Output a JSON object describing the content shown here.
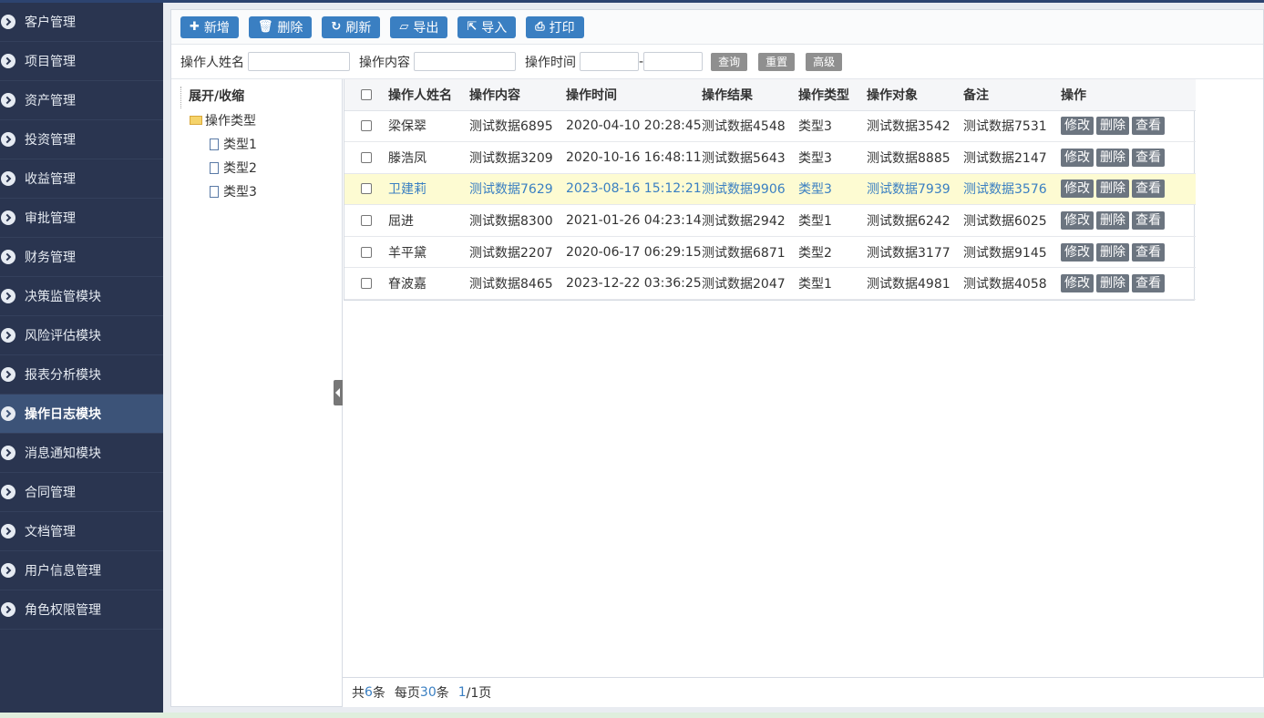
{
  "sidebar": {
    "items": [
      {
        "label": "客户管理",
        "active": false
      },
      {
        "label": "项目管理",
        "active": false
      },
      {
        "label": "资产管理",
        "active": false
      },
      {
        "label": "投资管理",
        "active": false
      },
      {
        "label": "收益管理",
        "active": false
      },
      {
        "label": "审批管理",
        "active": false
      },
      {
        "label": "财务管理",
        "active": false
      },
      {
        "label": "决策监管模块",
        "active": false
      },
      {
        "label": "风险评估模块",
        "active": false
      },
      {
        "label": "报表分析模块",
        "active": false
      },
      {
        "label": "操作日志模块",
        "active": true
      },
      {
        "label": "消息通知模块",
        "active": false
      },
      {
        "label": "合同管理",
        "active": false
      },
      {
        "label": "文档管理",
        "active": false
      },
      {
        "label": "用户信息管理",
        "active": false
      },
      {
        "label": "角色权限管理",
        "active": false
      }
    ]
  },
  "toolbar": {
    "add": "新增",
    "delete": "删除",
    "refresh": "刷新",
    "export": "导出",
    "import": "导入",
    "print": "打印"
  },
  "search": {
    "name_label": "操作人姓名",
    "name_value": "",
    "content_label": "操作内容",
    "content_value": "",
    "time_label": "操作时间",
    "time_start": "",
    "time_sep": "-",
    "time_end": "",
    "query": "查询",
    "reset": "重置",
    "advanced": "高级"
  },
  "tree": {
    "root": "展开/收缩",
    "folder": "操作类型",
    "children": [
      "类型1",
      "类型2",
      "类型3"
    ]
  },
  "table": {
    "headers": [
      "操作人姓名",
      "操作内容",
      "操作时间",
      "操作结果",
      "操作类型",
      "操作对象",
      "备注",
      "操作"
    ],
    "actions": [
      "修改",
      "删除",
      "查看"
    ],
    "rows": [
      [
        "梁保翠",
        "测试数据6895",
        "2020-04-10 20:28:45",
        "测试数据4548",
        "类型3",
        "测试数据3542",
        "测试数据7531"
      ],
      [
        "滕浩凤",
        "测试数据3209",
        "2020-10-16 16:48:11",
        "测试数据5643",
        "类型3",
        "测试数据8885",
        "测试数据2147"
      ],
      [
        "卫建莉",
        "测试数据7629",
        "2023-08-16 15:12:21",
        "测试数据9906",
        "类型3",
        "测试数据7939",
        "测试数据3576"
      ],
      [
        "屈进",
        "测试数据8300",
        "2021-01-26 04:23:14",
        "测试数据2942",
        "类型1",
        "测试数据6242",
        "测试数据6025"
      ],
      [
        "羊平黛",
        "测试数据2207",
        "2020-06-17 06:29:15",
        "测试数据6871",
        "类型2",
        "测试数据3177",
        "测试数据9145"
      ],
      [
        "眘波嘉",
        "测试数据8465",
        "2023-12-22 03:36:25",
        "测试数据2047",
        "类型1",
        "测试数据4981",
        "测试数据4058"
      ]
    ],
    "highlighted_row": 2
  },
  "pager": {
    "total_prefix": "共",
    "total": "6",
    "total_suffix": "条",
    "per_prefix": "每页",
    "per_page": "30",
    "per_suffix": "条",
    "current": "1",
    "pages": "/1页"
  },
  "colors": {
    "sidebar_bg": "#2a3550",
    "sidebar_active": "#3c5378",
    "primary": "#3a7fc2",
    "highlight_row": "#fdfbd2"
  }
}
